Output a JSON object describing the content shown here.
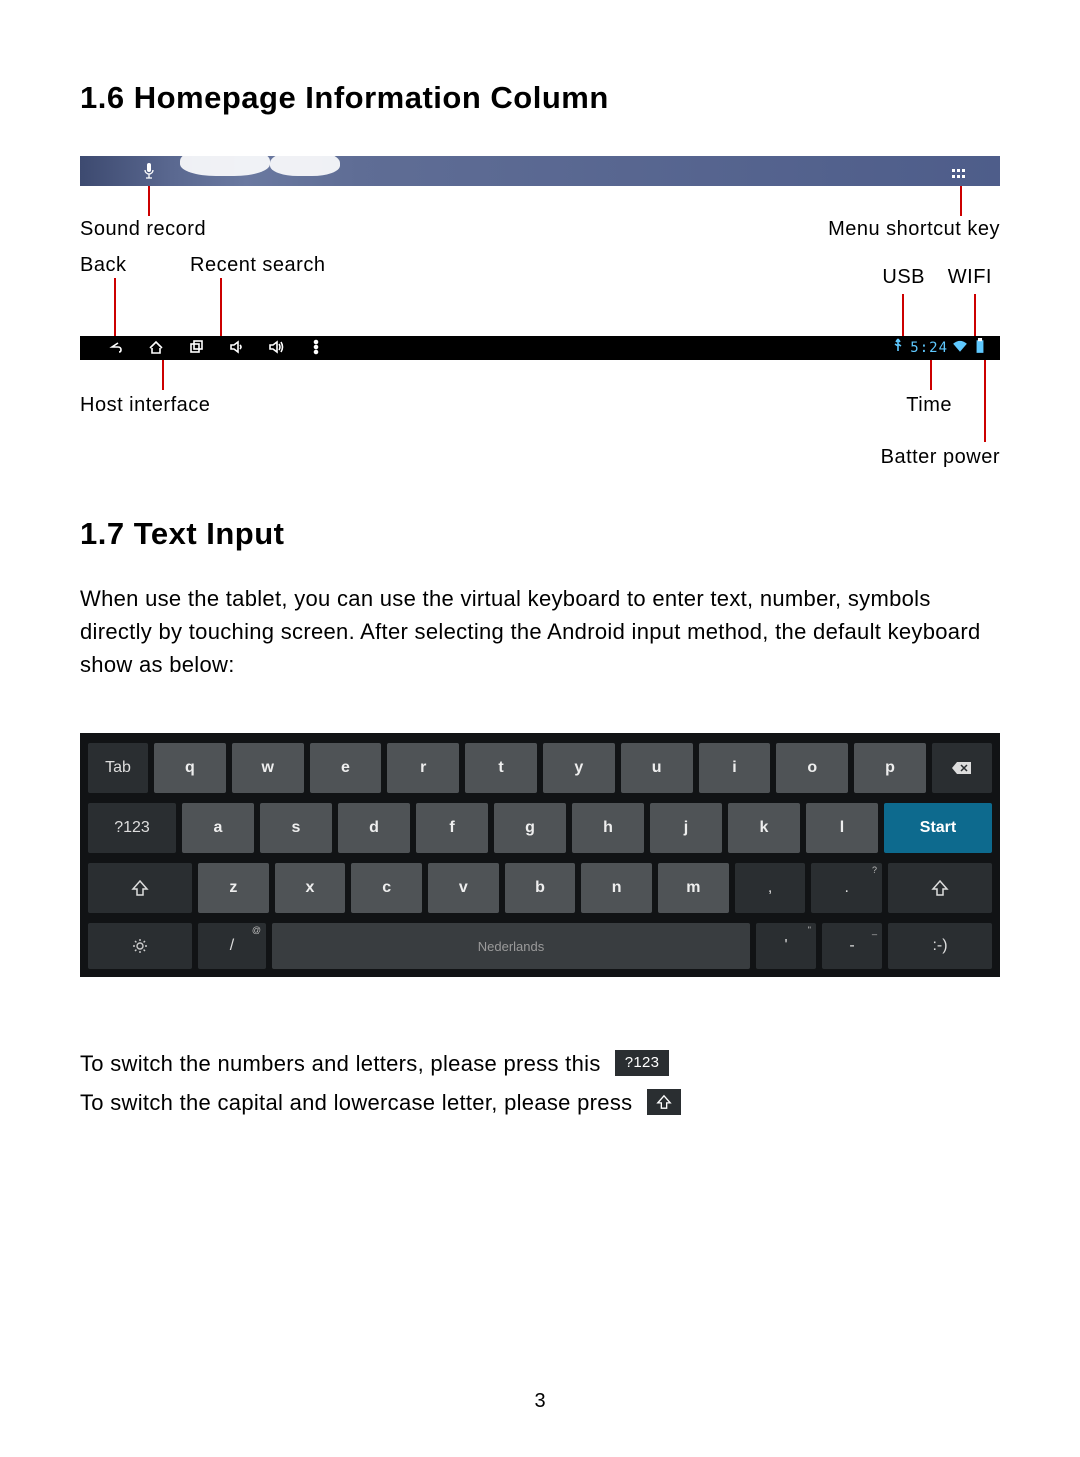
{
  "section16": {
    "heading": "1.6 Homepage Information Column",
    "labels": {
      "sound_record": "Sound record",
      "back": "Back",
      "recent_search": "Recent search",
      "menu_shortcut": "Menu shortcut key",
      "usb": "USB",
      "wifi": "WIFI",
      "host_interface": "Host interface",
      "time": "Time",
      "batter_power": "Batter power"
    },
    "sysbar": {
      "time": "5:24",
      "icons": {
        "back": "back-icon",
        "home": "home-icon",
        "recent": "recent-apps-icon",
        "vol_down": "volume-down-icon",
        "vol_up": "volume-up-icon",
        "more": "more-icon",
        "usb": "usb-icon",
        "wifi": "wifi-icon",
        "battery": "battery-icon"
      }
    },
    "topbar": {
      "mic_icon": "microphone-icon",
      "menu_icon": "app-grid-icon"
    }
  },
  "section17": {
    "heading": "1.7 Text Input",
    "para": "When use the tablet, you can use the virtual keyboard to enter text, number, symbols directly by touching screen. After selecting the Android input method, the default keyboard show as below:",
    "footer_line1": "To switch the numbers and letters, please press this",
    "footer_line2": "To switch the capital and lowercase letter, please press",
    "inline_123": "?123",
    "inline_shift": "⇧"
  },
  "keyboard": {
    "row1_left": "Tab",
    "row1": [
      "q",
      "w",
      "e",
      "r",
      "t",
      "y",
      "u",
      "i",
      "o",
      "p"
    ],
    "row1_right": "⌫",
    "row2_left": "?123",
    "row2": [
      "a",
      "s",
      "d",
      "f",
      "g",
      "h",
      "j",
      "k",
      "l"
    ],
    "row2_right": "Start",
    "row3_left": "⇧",
    "row3": [
      "z",
      "x",
      "c",
      "v",
      "b",
      "n",
      "m",
      ",",
      "."
    ],
    "row3_right": "⇧",
    "row4": {
      "settings": "⚙",
      "slash": "/",
      "slash_sub": "@",
      "space": "Nederlands",
      "apos": "'",
      "apos_sub": "\"",
      "dash": "-",
      "dash_sub": "_",
      "smile": ":-)"
    }
  },
  "page_number": "3"
}
